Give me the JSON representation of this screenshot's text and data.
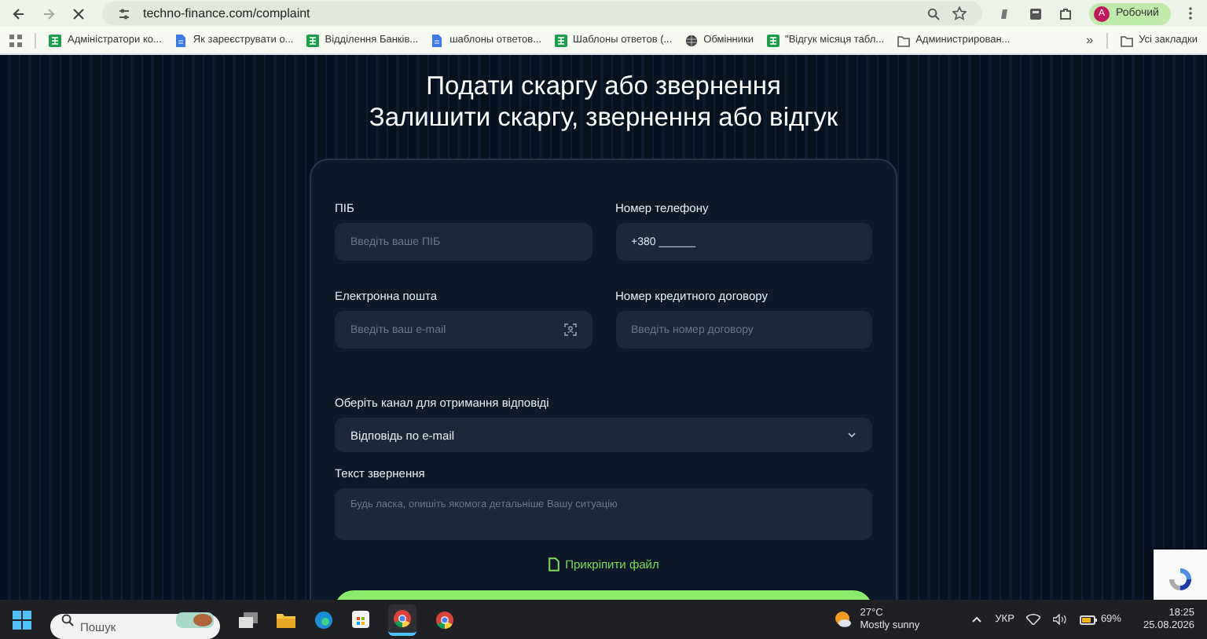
{
  "browser": {
    "url": "techno-finance.com/complaint",
    "profile": {
      "initial": "A",
      "label": "Робочий"
    },
    "bookmarks": [
      {
        "kind": "sheet",
        "label": "Адміністратори ко..."
      },
      {
        "kind": "doc",
        "label": "Як зареєструвати о..."
      },
      {
        "kind": "sheet",
        "label": "Відділення Банків..."
      },
      {
        "kind": "doc",
        "label": "шаблоны ответов..."
      },
      {
        "kind": "sheet",
        "label": "Шаблоны ответов (..."
      },
      {
        "kind": "globe",
        "label": "Обмінники"
      },
      {
        "kind": "sheet",
        "label": "\"Відгук місяця табл..."
      },
      {
        "kind": "folder",
        "label": "Администрирован..."
      }
    ],
    "overflow": "»",
    "all_bookmarks": "Усі закладки"
  },
  "page": {
    "title": "Подати скаргу або звернення",
    "subtitle": "Залишити скаргу, звернення або відгук",
    "fields": [
      {
        "kind": "input",
        "label": "ПІБ",
        "placeholder": "Введіть ваше ПІБ"
      },
      {
        "kind": "input",
        "label": "Номер телефону",
        "value": "+380 ______"
      },
      {
        "kind": "input",
        "label": "Електронна пошта",
        "placeholder": "Введіть ваш e-mail",
        "icon": true
      },
      {
        "kind": "input",
        "label": "Номер кредитного договору",
        "placeholder": "Введіть номер договору"
      },
      {
        "kind": "select",
        "label": "Оберіть канал для отримання відповіді",
        "value": "Відповідь по e-mail"
      },
      {
        "kind": "textarea",
        "label": "Текст звернення",
        "placeholder": "Будь ласка, опишіть якомога детальніше Вашу ситуацію"
      }
    ],
    "attach": "Прикріпити файл"
  },
  "taskbar": {
    "search": {
      "placeholder": "Пошук"
    },
    "weather": {
      "temp": "27°C",
      "condition": "Mostly sunny"
    },
    "language": "УКР",
    "battery": "69%",
    "time": "18:25",
    "date": "25.08.2026"
  }
}
